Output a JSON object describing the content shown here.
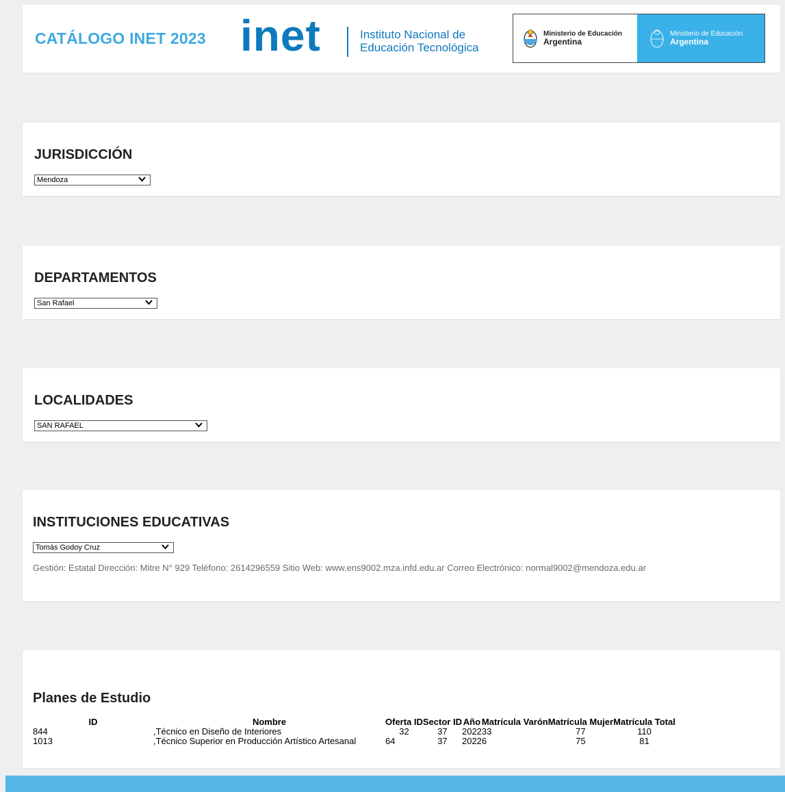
{
  "header": {
    "title": "CATÁLOGO INET 2023",
    "logo_text": "inet",
    "logo_subtitle_line1": "Instituto Nacional de",
    "logo_subtitle_line2": "Educación Tecnológica",
    "ministerio_left_line1": "Ministerio de Educación",
    "ministerio_left_line2": "Argentina",
    "ministerio_right_line1": "Ministerio de Educación",
    "ministerio_right_line2": "Argentina"
  },
  "jurisdiccion": {
    "title": "JURISDICCIÓN",
    "selected": "Mendoza"
  },
  "departamentos": {
    "title": "DEPARTAMENTOS",
    "selected": "San Rafael"
  },
  "localidades": {
    "title": "LOCALIDADES",
    "selected": "SAN RAFAEL"
  },
  "instituciones": {
    "title": "INSTITUCIONES EDUCATIVAS",
    "selected": "Tomás Godoy Cruz",
    "info": "Gestión: Estatal Dirección: Mitre N° 929 Teléfono: 2614296559 Sitio Web: www.ens9002.mza.infd.edu.ar Correo Electrónico: normal9002@mendoza.edu.ar"
  },
  "planes": {
    "title": "Planes de Estudio",
    "headers": [
      "ID",
      "Nombre",
      "Oferta ID",
      "Sector ID",
      "Año",
      "Matrícula Varón",
      "Matrícula Mujer",
      "Matrícula Total"
    ],
    "rows": [
      [
        "844",
        ",Técnico en Diseño de Interiores",
        "32",
        "37",
        "2022",
        "33",
        "77",
        "110"
      ],
      [
        "1013",
        ",Técnico Superior en Producción Artístico Artesanal",
        "64",
        "37",
        "2022",
        "6",
        "75",
        "81"
      ]
    ]
  },
  "colors": {
    "accent": "#3fa9e0",
    "inet_blue": "#0f79bd",
    "footer": "#56b7e7"
  }
}
